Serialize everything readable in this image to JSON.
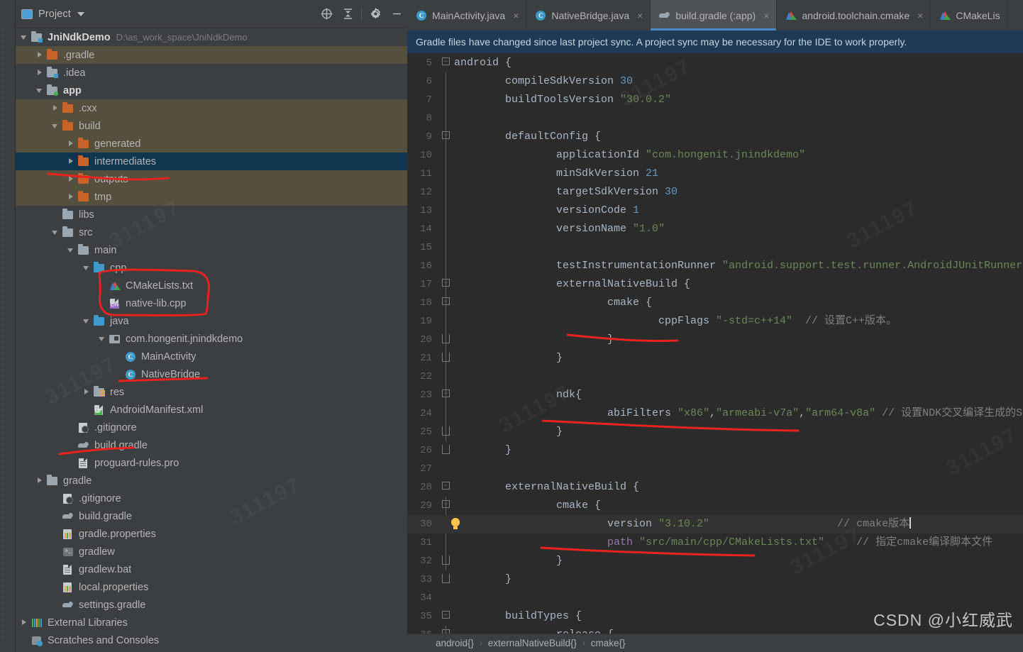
{
  "panel": {
    "title": "Project",
    "icons": [
      "project-view-icon",
      "target-icon",
      "collapse-all-icon",
      "gear-icon",
      "minimize-icon"
    ]
  },
  "tree": [
    {
      "label": "JniNdkDemo",
      "hint": "D:\\as_work_space\\JniNdkDemo",
      "depth": 0,
      "arrow": "down",
      "icon": "folder-module",
      "bold": true,
      "state": "normal"
    },
    {
      "label": ".gradle",
      "hint": "",
      "depth": 1,
      "arrow": "right",
      "icon": "folder-orange",
      "bold": false,
      "state": "excluded"
    },
    {
      "label": ".idea",
      "hint": "",
      "depth": 1,
      "arrow": "right",
      "icon": "folder-module",
      "bold": false,
      "state": "normal"
    },
    {
      "label": "app",
      "hint": "",
      "depth": 1,
      "arrow": "down",
      "icon": "folder-module-green",
      "bold": true,
      "state": "normal"
    },
    {
      "label": ".cxx",
      "hint": "",
      "depth": 2,
      "arrow": "right",
      "icon": "folder-orange",
      "bold": false,
      "state": "excluded"
    },
    {
      "label": "build",
      "hint": "",
      "depth": 2,
      "arrow": "down",
      "icon": "folder-orange",
      "bold": false,
      "state": "excluded"
    },
    {
      "label": "generated",
      "hint": "",
      "depth": 3,
      "arrow": "right",
      "icon": "folder-orange",
      "bold": false,
      "state": "excluded"
    },
    {
      "label": "intermediates",
      "hint": "",
      "depth": 3,
      "arrow": "right",
      "icon": "folder-orange",
      "bold": false,
      "state": "selected"
    },
    {
      "label": "outputs",
      "hint": "",
      "depth": 3,
      "arrow": "right",
      "icon": "folder-orange",
      "bold": false,
      "state": "excluded"
    },
    {
      "label": "tmp",
      "hint": "",
      "depth": 3,
      "arrow": "right",
      "icon": "folder-orange",
      "bold": false,
      "state": "excluded"
    },
    {
      "label": "libs",
      "hint": "",
      "depth": 2,
      "arrow": "none",
      "icon": "folder-grey",
      "bold": false,
      "state": "normal"
    },
    {
      "label": "src",
      "hint": "",
      "depth": 2,
      "arrow": "down",
      "icon": "folder-grey",
      "bold": false,
      "state": "normal"
    },
    {
      "label": "main",
      "hint": "",
      "depth": 3,
      "arrow": "down",
      "icon": "folder-grey",
      "bold": false,
      "state": "normal"
    },
    {
      "label": "cpp",
      "hint": "",
      "depth": 4,
      "arrow": "down",
      "icon": "folder-blue",
      "bold": false,
      "state": "normal"
    },
    {
      "label": "CMakeLists.txt",
      "hint": "",
      "depth": 5,
      "arrow": "none",
      "icon": "cmake-file",
      "bold": false,
      "state": "normal"
    },
    {
      "label": "native-lib.cpp",
      "hint": "",
      "depth": 5,
      "arrow": "none",
      "icon": "cpp-file",
      "bold": false,
      "state": "normal"
    },
    {
      "label": "java",
      "hint": "",
      "depth": 4,
      "arrow": "down",
      "icon": "folder-blue",
      "bold": false,
      "state": "normal"
    },
    {
      "label": "com.hongenit.jnindkdemo",
      "hint": "",
      "depth": 5,
      "arrow": "down",
      "icon": "package",
      "bold": false,
      "state": "normal"
    },
    {
      "label": "MainActivity",
      "hint": "",
      "depth": 6,
      "arrow": "none",
      "icon": "java-class",
      "bold": false,
      "state": "normal"
    },
    {
      "label": "NativeBridge",
      "hint": "",
      "depth": 6,
      "arrow": "none",
      "icon": "java-class",
      "bold": false,
      "state": "normal"
    },
    {
      "label": "res",
      "hint": "",
      "depth": 4,
      "arrow": "right",
      "icon": "folder-res",
      "bold": false,
      "state": "normal"
    },
    {
      "label": "AndroidManifest.xml",
      "hint": "",
      "depth": 4,
      "arrow": "none",
      "icon": "manifest-file",
      "bold": false,
      "state": "normal"
    },
    {
      "label": ".gitignore",
      "hint": "",
      "depth": 3,
      "arrow": "none",
      "icon": "gitignore-file",
      "bold": false,
      "state": "normal"
    },
    {
      "label": "build.gradle",
      "hint": "",
      "depth": 3,
      "arrow": "none",
      "icon": "gradle-file",
      "bold": false,
      "state": "normal"
    },
    {
      "label": "proguard-rules.pro",
      "hint": "",
      "depth": 3,
      "arrow": "none",
      "icon": "text-file",
      "bold": false,
      "state": "normal"
    },
    {
      "label": "gradle",
      "hint": "",
      "depth": 1,
      "arrow": "right",
      "icon": "folder-grey",
      "bold": false,
      "state": "normal"
    },
    {
      "label": ".gitignore",
      "hint": "",
      "depth": 2,
      "arrow": "none",
      "icon": "gitignore-file",
      "bold": false,
      "state": "normal"
    },
    {
      "label": "build.gradle",
      "hint": "",
      "depth": 2,
      "arrow": "none",
      "icon": "gradle-file",
      "bold": false,
      "state": "normal"
    },
    {
      "label": "gradle.properties",
      "hint": "",
      "depth": 2,
      "arrow": "none",
      "icon": "properties-file",
      "bold": false,
      "state": "normal"
    },
    {
      "label": "gradlew",
      "hint": "",
      "depth": 2,
      "arrow": "none",
      "icon": "shell-file",
      "bold": false,
      "state": "normal"
    },
    {
      "label": "gradlew.bat",
      "hint": "",
      "depth": 2,
      "arrow": "none",
      "icon": "text-file",
      "bold": false,
      "state": "normal"
    },
    {
      "label": "local.properties",
      "hint": "",
      "depth": 2,
      "arrow": "none",
      "icon": "properties-file",
      "bold": false,
      "state": "normal"
    },
    {
      "label": "settings.gradle",
      "hint": "",
      "depth": 2,
      "arrow": "none",
      "icon": "gradle-file",
      "bold": false,
      "state": "normal"
    },
    {
      "label": "External Libraries",
      "hint": "",
      "depth": 0,
      "arrow": "right",
      "icon": "external-libraries",
      "bold": false,
      "state": "normal"
    },
    {
      "label": "Scratches and Consoles",
      "hint": "",
      "depth": 0,
      "arrow": "none",
      "icon": "scratches",
      "bold": false,
      "state": "normal"
    }
  ],
  "tabs": [
    {
      "label": "MainActivity.java",
      "icon": "java-class",
      "active": false,
      "close": "×"
    },
    {
      "label": "NativeBridge.java",
      "icon": "java-class",
      "active": false,
      "close": "×"
    },
    {
      "label": "build.gradle (:app)",
      "icon": "gradle-file",
      "active": true,
      "close": "×"
    },
    {
      "label": "android.toolchain.cmake",
      "icon": "cmake-file",
      "active": false,
      "close": "×"
    },
    {
      "label": "CMakeLis",
      "icon": "cmake-file",
      "active": false,
      "close": ""
    }
  ],
  "notification": "Gradle files have changed since last project sync. A project sync may be necessary for the IDE to work properly.",
  "code": {
    "first_line": 5,
    "lines": [
      {
        "n": 5,
        "fold": "minus-top",
        "current": false,
        "tokens": [
          {
            "t": "android {",
            "c": "plain"
          }
        ],
        "indent": 0
      },
      {
        "n": 6,
        "fold": "arm",
        "current": false,
        "tokens": [
          {
            "t": "compileSdkVersion ",
            "c": "plain"
          },
          {
            "t": "30",
            "c": "n"
          }
        ],
        "indent": 1
      },
      {
        "n": 7,
        "fold": "arm",
        "current": false,
        "tokens": [
          {
            "t": "buildToolsVersion ",
            "c": "plain"
          },
          {
            "t": "\"30.0.2\"",
            "c": "s"
          }
        ],
        "indent": 1
      },
      {
        "n": 8,
        "fold": "arm",
        "current": false,
        "tokens": [],
        "indent": 1
      },
      {
        "n": 9,
        "fold": "minus-arm",
        "current": false,
        "tokens": [
          {
            "t": "defaultConfig {",
            "c": "plain"
          }
        ],
        "indent": 1
      },
      {
        "n": 10,
        "fold": "arm",
        "current": false,
        "tokens": [
          {
            "t": "applicationId ",
            "c": "plain"
          },
          {
            "t": "\"com.hongenit.jnindkdemo\"",
            "c": "s"
          }
        ],
        "indent": 2
      },
      {
        "n": 11,
        "fold": "arm",
        "current": false,
        "tokens": [
          {
            "t": "minSdkVersion ",
            "c": "plain"
          },
          {
            "t": "21",
            "c": "n"
          }
        ],
        "indent": 2
      },
      {
        "n": 12,
        "fold": "arm",
        "current": false,
        "tokens": [
          {
            "t": "targetSdkVersion ",
            "c": "plain"
          },
          {
            "t": "30",
            "c": "n"
          }
        ],
        "indent": 2
      },
      {
        "n": 13,
        "fold": "arm",
        "current": false,
        "tokens": [
          {
            "t": "versionCode ",
            "c": "plain"
          },
          {
            "t": "1",
            "c": "n"
          }
        ],
        "indent": 2
      },
      {
        "n": 14,
        "fold": "arm",
        "current": false,
        "tokens": [
          {
            "t": "versionName ",
            "c": "plain"
          },
          {
            "t": "\"1.0\"",
            "c": "s"
          }
        ],
        "indent": 2
      },
      {
        "n": 15,
        "fold": "arm",
        "current": false,
        "tokens": [],
        "indent": 2
      },
      {
        "n": 16,
        "fold": "arm",
        "current": false,
        "tokens": [
          {
            "t": "testInstrumentationRunner ",
            "c": "plain"
          },
          {
            "t": "\"android.support.test.runner.AndroidJUnitRunner\"",
            "c": "s"
          }
        ],
        "indent": 2
      },
      {
        "n": 17,
        "fold": "minus-arm",
        "current": false,
        "tokens": [
          {
            "t": "externalNativeBuild {",
            "c": "plain"
          }
        ],
        "indent": 2
      },
      {
        "n": 18,
        "fold": "minus-arm",
        "current": false,
        "tokens": [
          {
            "t": "cmake {",
            "c": "plain"
          }
        ],
        "indent": 3
      },
      {
        "n": 19,
        "fold": "arm",
        "current": false,
        "tokens": [
          {
            "t": "cppFlags ",
            "c": "plain"
          },
          {
            "t": "\"-std=c++14\"",
            "c": "s"
          },
          {
            "t": "  // 设置C++版本。",
            "c": "c"
          }
        ],
        "indent": 4
      },
      {
        "n": 20,
        "fold": "cap-arm",
        "current": false,
        "tokens": [
          {
            "t": "}",
            "c": "plain"
          }
        ],
        "indent": 3
      },
      {
        "n": 21,
        "fold": "cap-arm",
        "current": false,
        "tokens": [
          {
            "t": "}",
            "c": "plain"
          }
        ],
        "indent": 2
      },
      {
        "n": 22,
        "fold": "arm",
        "current": false,
        "tokens": [],
        "indent": 2
      },
      {
        "n": 23,
        "fold": "minus-arm",
        "current": false,
        "tokens": [
          {
            "t": "ndk{",
            "c": "plain"
          }
        ],
        "indent": 2
      },
      {
        "n": 24,
        "fold": "arm",
        "current": false,
        "tokens": [
          {
            "t": "abiFilters ",
            "c": "plain"
          },
          {
            "t": "\"x86\"",
            "c": "s"
          },
          {
            "t": ",",
            "c": "plain"
          },
          {
            "t": "\"armeabi-v7a\"",
            "c": "s"
          },
          {
            "t": ",",
            "c": "plain"
          },
          {
            "t": "\"arm64-v8a\"",
            "c": "s"
          },
          {
            "t": " // 设置NDK交叉编译生成的SO架构",
            "c": "c"
          }
        ],
        "indent": 3
      },
      {
        "n": 25,
        "fold": "cap-arm",
        "current": false,
        "tokens": [
          {
            "t": "}",
            "c": "plain"
          }
        ],
        "indent": 2
      },
      {
        "n": 26,
        "fold": "cap",
        "current": false,
        "tokens": [
          {
            "t": "}",
            "c": "plain"
          }
        ],
        "indent": 1
      },
      {
        "n": 27,
        "fold": "none",
        "current": false,
        "tokens": [],
        "indent": 1
      },
      {
        "n": 28,
        "fold": "minus",
        "current": false,
        "tokens": [
          {
            "t": "externalNativeBuild {",
            "c": "plain"
          }
        ],
        "indent": 1
      },
      {
        "n": 29,
        "fold": "minus-arm",
        "current": false,
        "tokens": [
          {
            "t": "cmake {",
            "c": "plain"
          }
        ],
        "indent": 2
      },
      {
        "n": 30,
        "fold": "bulb",
        "current": true,
        "tokens": [
          {
            "t": "version ",
            "c": "plain"
          },
          {
            "t": "\"3.10.2\"",
            "c": "s"
          },
          {
            "t": "                    // cmake版本",
            "c": "c"
          }
        ],
        "indent": 3
      },
      {
        "n": 31,
        "fold": "arm",
        "current": false,
        "tokens": [
          {
            "t": "path ",
            "c": "p"
          },
          {
            "t": "\"src/main/cpp/CMakeLists.txt\"",
            "c": "s"
          },
          {
            "t": "     // 指定cmake编译脚本文件",
            "c": "c"
          }
        ],
        "indent": 3
      },
      {
        "n": 32,
        "fold": "cap-arm",
        "current": false,
        "tokens": [
          {
            "t": "}",
            "c": "plain"
          }
        ],
        "indent": 2
      },
      {
        "n": 33,
        "fold": "cap",
        "current": false,
        "tokens": [
          {
            "t": "}",
            "c": "plain"
          }
        ],
        "indent": 1
      },
      {
        "n": 34,
        "fold": "none",
        "current": false,
        "tokens": [],
        "indent": 1
      },
      {
        "n": 35,
        "fold": "minus",
        "current": false,
        "tokens": [
          {
            "t": "buildTypes {",
            "c": "plain"
          }
        ],
        "indent": 1
      },
      {
        "n": 36,
        "fold": "minus-arm",
        "current": false,
        "tokens": [
          {
            "t": "release {",
            "c": "plain"
          }
        ],
        "indent": 2
      }
    ]
  },
  "breadcrumb": [
    "android{}",
    "externalNativeBuild{}",
    "cmake{}"
  ],
  "breadcrumb_sep": "›",
  "watermark": "311197",
  "csdn_watermark": "CSDN @小红威武",
  "colors": {
    "accent": "#4a88c7",
    "excluded_row": "#554f3d",
    "selected_row": "#10364f",
    "notification_bg": "#1e3a55",
    "annotation_red": "#e8231f",
    "editor_bg": "#2b2b2b",
    "panel_bg": "#3c3f41"
  }
}
